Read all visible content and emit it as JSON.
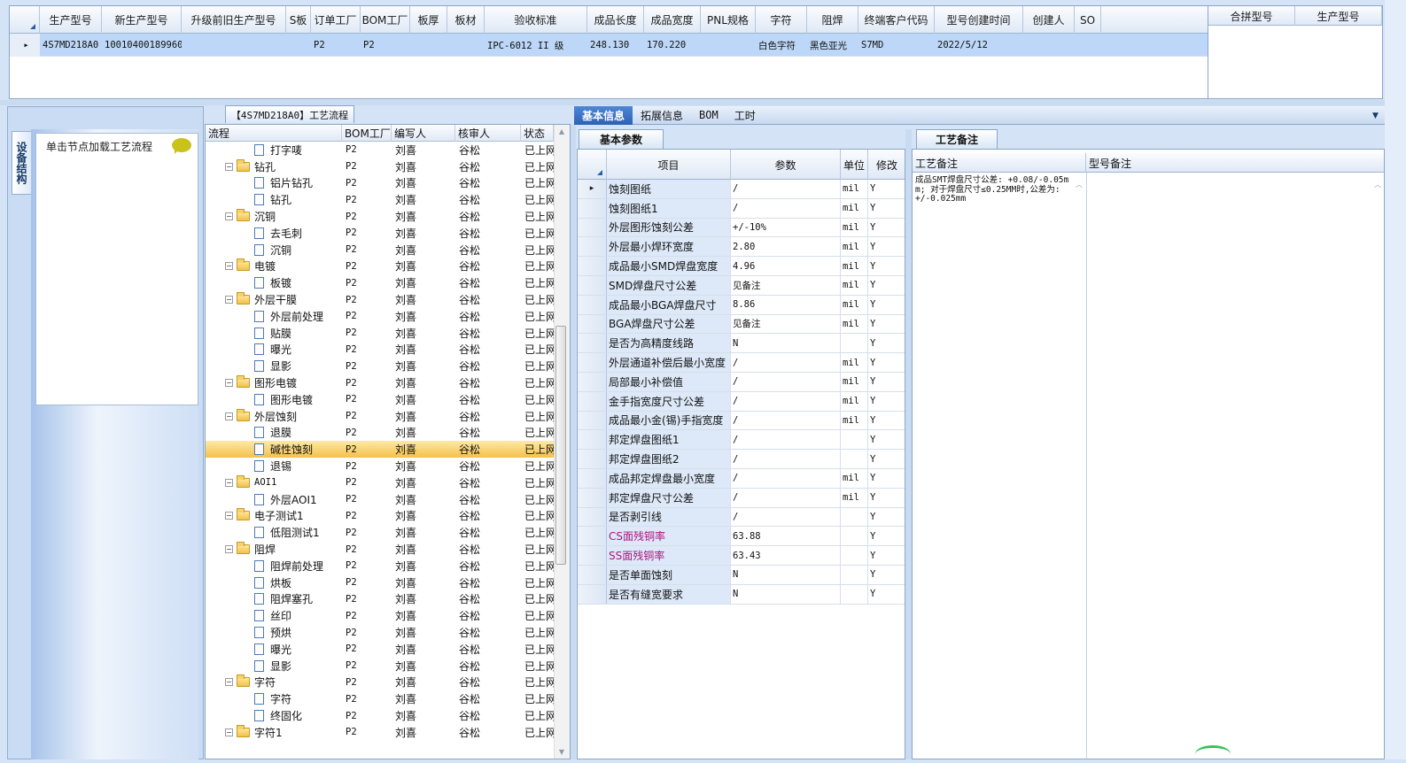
{
  "top_grid": {
    "columns": [
      "生产型号",
      "新生产型号",
      "升级前旧生产型号",
      "S板",
      "订单工厂",
      "BOM工厂",
      "板厚",
      "板材",
      "验收标准",
      "成品长度",
      "成品宽度",
      "PNL规格",
      "字符",
      "阻焊",
      "终端客户代码",
      "型号创建时间",
      "创建人",
      "SO"
    ],
    "row": [
      "4S7MD218A0",
      "10010400189960",
      "",
      "",
      "P2",
      "P2",
      "",
      "",
      "IPC-6012 II 级",
      "248.130",
      "170.220",
      "",
      "白色字符",
      "黑色亚光",
      "S7MD",
      "2022/5/12",
      "",
      ""
    ]
  },
  "right_grid": {
    "columns": [
      "合拼型号",
      "生产型号"
    ]
  },
  "left_panel": {
    "vertical_tab": "设备结构",
    "load_text": "单击节点加载工艺流程"
  },
  "tree": {
    "title": "【4S7MD218A0】工艺流程",
    "columns": [
      "流程",
      "BOM工厂",
      "编写人",
      "核审人",
      "状态"
    ],
    "rows": [
      {
        "name": "打字唛",
        "level": 2,
        "bom": "P2",
        "writer": "刘喜",
        "reviewer": "谷松",
        "status": "已上网"
      },
      {
        "name": "钻孔",
        "level": 1,
        "bom": "P2",
        "writer": "刘喜",
        "reviewer": "谷松",
        "status": "已上网"
      },
      {
        "name": "铝片钻孔",
        "level": 2,
        "bom": "P2",
        "writer": "刘喜",
        "reviewer": "谷松",
        "status": "已上网"
      },
      {
        "name": "钻孔",
        "level": 2,
        "bom": "P2",
        "writer": "刘喜",
        "reviewer": "谷松",
        "status": "已上网"
      },
      {
        "name": "沉铜",
        "level": 1,
        "bom": "P2",
        "writer": "刘喜",
        "reviewer": "谷松",
        "status": "已上网"
      },
      {
        "name": "去毛刺",
        "level": 2,
        "bom": "P2",
        "writer": "刘喜",
        "reviewer": "谷松",
        "status": "已上网"
      },
      {
        "name": "沉铜",
        "level": 2,
        "bom": "P2",
        "writer": "刘喜",
        "reviewer": "谷松",
        "status": "已上网"
      },
      {
        "name": "电镀",
        "level": 1,
        "bom": "P2",
        "writer": "刘喜",
        "reviewer": "谷松",
        "status": "已上网"
      },
      {
        "name": "板镀",
        "level": 2,
        "bom": "P2",
        "writer": "刘喜",
        "reviewer": "谷松",
        "status": "已上网"
      },
      {
        "name": "外层干膜",
        "level": 1,
        "bom": "P2",
        "writer": "刘喜",
        "reviewer": "谷松",
        "status": "已上网"
      },
      {
        "name": "外层前处理",
        "level": 2,
        "bom": "P2",
        "writer": "刘喜",
        "reviewer": "谷松",
        "status": "已上网"
      },
      {
        "name": "贴膜",
        "level": 2,
        "bom": "P2",
        "writer": "刘喜",
        "reviewer": "谷松",
        "status": "已上网"
      },
      {
        "name": "曝光",
        "level": 2,
        "bom": "P2",
        "writer": "刘喜",
        "reviewer": "谷松",
        "status": "已上网"
      },
      {
        "name": "显影",
        "level": 2,
        "bom": "P2",
        "writer": "刘喜",
        "reviewer": "谷松",
        "status": "已上网"
      },
      {
        "name": "图形电镀",
        "level": 1,
        "bom": "P2",
        "writer": "刘喜",
        "reviewer": "谷松",
        "status": "已上网"
      },
      {
        "name": "图形电镀",
        "level": 2,
        "bom": "P2",
        "writer": "刘喜",
        "reviewer": "谷松",
        "status": "已上网"
      },
      {
        "name": "外层蚀刻",
        "level": 1,
        "bom": "P2",
        "writer": "刘喜",
        "reviewer": "谷松",
        "status": "已上网"
      },
      {
        "name": "退膜",
        "level": 2,
        "bom": "P2",
        "writer": "刘喜",
        "reviewer": "谷松",
        "status": "已上网"
      },
      {
        "name": "碱性蚀刻",
        "level": 2,
        "bom": "P2",
        "writer": "刘喜",
        "reviewer": "谷松",
        "status": "已上网",
        "selected": true
      },
      {
        "name": "退锡",
        "level": 2,
        "bom": "P2",
        "writer": "刘喜",
        "reviewer": "谷松",
        "status": "已上网"
      },
      {
        "name": "AOI1",
        "level": 1,
        "bom": "P2",
        "writer": "刘喜",
        "reviewer": "谷松",
        "status": "已上网"
      },
      {
        "name": "外层AOI1",
        "level": 2,
        "bom": "P2",
        "writer": "刘喜",
        "reviewer": "谷松",
        "status": "已上网"
      },
      {
        "name": "电子测试1",
        "level": 1,
        "bom": "P2",
        "writer": "刘喜",
        "reviewer": "谷松",
        "status": "已上网"
      },
      {
        "name": "低阻测试1",
        "level": 2,
        "bom": "P2",
        "writer": "刘喜",
        "reviewer": "谷松",
        "status": "已上网"
      },
      {
        "name": "阻焊",
        "level": 1,
        "bom": "P2",
        "writer": "刘喜",
        "reviewer": "谷松",
        "status": "已上网"
      },
      {
        "name": "阻焊前处理",
        "level": 2,
        "bom": "P2",
        "writer": "刘喜",
        "reviewer": "谷松",
        "status": "已上网"
      },
      {
        "name": "烘板",
        "level": 2,
        "bom": "P2",
        "writer": "刘喜",
        "reviewer": "谷松",
        "status": "已上网"
      },
      {
        "name": "阻焊塞孔",
        "level": 2,
        "bom": "P2",
        "writer": "刘喜",
        "reviewer": "谷松",
        "status": "已上网"
      },
      {
        "name": "丝印",
        "level": 2,
        "bom": "P2",
        "writer": "刘喜",
        "reviewer": "谷松",
        "status": "已上网"
      },
      {
        "name": "预烘",
        "level": 2,
        "bom": "P2",
        "writer": "刘喜",
        "reviewer": "谷松",
        "status": "已上网"
      },
      {
        "name": "曝光",
        "level": 2,
        "bom": "P2",
        "writer": "刘喜",
        "reviewer": "谷松",
        "status": "已上网"
      },
      {
        "name": "显影",
        "level": 2,
        "bom": "P2",
        "writer": "刘喜",
        "reviewer": "谷松",
        "status": "已上网"
      },
      {
        "name": "字符",
        "level": 1,
        "bom": "P2",
        "writer": "刘喜",
        "reviewer": "谷松",
        "status": "已上网"
      },
      {
        "name": "字符",
        "level": 2,
        "bom": "P2",
        "writer": "刘喜",
        "reviewer": "谷松",
        "status": "已上网"
      },
      {
        "name": "终固化",
        "level": 2,
        "bom": "P2",
        "writer": "刘喜",
        "reviewer": "谷松",
        "status": "已上网"
      },
      {
        "name": "字符1",
        "level": 1,
        "bom": "P2",
        "writer": "刘喜",
        "reviewer": "谷松",
        "status": "已上网"
      }
    ]
  },
  "right_tabs": [
    "基本信息",
    "拓展信息",
    "BOM",
    "工时"
  ],
  "params": {
    "tab_label": "基本参数",
    "columns": [
      "项目",
      "参数",
      "单位",
      "修改"
    ],
    "rows": [
      {
        "name": "蚀刻图纸",
        "value": "/",
        "unit": "mil",
        "mod": "Y",
        "pink": false
      },
      {
        "name": "蚀刻图纸1",
        "value": "/",
        "unit": "mil",
        "mod": "Y",
        "pink": false
      },
      {
        "name": "外层图形蚀刻公差",
        "value": "+/-10%",
        "unit": "mil",
        "mod": "Y",
        "pink": false
      },
      {
        "name": "外层最小焊环宽度",
        "value": "2.80",
        "unit": "mil",
        "mod": "Y",
        "pink": false
      },
      {
        "name": "成品最小SMD焊盘宽度",
        "value": "4.96",
        "unit": "mil",
        "mod": "Y",
        "pink": false
      },
      {
        "name": "SMD焊盘尺寸公差",
        "value": "见备注",
        "unit": "mil",
        "mod": "Y",
        "pink": false
      },
      {
        "name": "成品最小BGA焊盘尺寸",
        "value": "8.86",
        "unit": "mil",
        "mod": "Y",
        "pink": false
      },
      {
        "name": "BGA焊盘尺寸公差",
        "value": "见备注",
        "unit": "mil",
        "mod": "Y",
        "pink": false
      },
      {
        "name": "是否为高精度线路",
        "value": "N",
        "unit": "",
        "mod": "Y",
        "pink": false
      },
      {
        "name": "外层通道补偿后最小宽度",
        "value": "/",
        "unit": "mil",
        "mod": "Y",
        "pink": false
      },
      {
        "name": "局部最小补偿值",
        "value": "/",
        "unit": "mil",
        "mod": "Y",
        "pink": false
      },
      {
        "name": "金手指宽度尺寸公差",
        "value": "/",
        "unit": "mil",
        "mod": "Y",
        "pink": false
      },
      {
        "name": "成品最小金(锡)手指宽度",
        "value": "/",
        "unit": "mil",
        "mod": "Y",
        "pink": false
      },
      {
        "name": "邦定焊盘图纸1",
        "value": "/",
        "unit": "",
        "mod": "Y",
        "pink": false
      },
      {
        "name": "邦定焊盘图纸2",
        "value": "/",
        "unit": "",
        "mod": "Y",
        "pink": false
      },
      {
        "name": "成品邦定焊盘最小宽度",
        "value": "/",
        "unit": "mil",
        "mod": "Y",
        "pink": false
      },
      {
        "name": "邦定焊盘尺寸公差",
        "value": "/",
        "unit": "mil",
        "mod": "Y",
        "pink": false
      },
      {
        "name": "是否剥引线",
        "value": "/",
        "unit": "",
        "mod": "Y",
        "pink": false
      },
      {
        "name": "CS面残铜率",
        "value": "63.88",
        "unit": "",
        "mod": "Y",
        "pink": true
      },
      {
        "name": "SS面残铜率",
        "value": "63.43",
        "unit": "",
        "mod": "Y",
        "pink": true
      },
      {
        "name": "是否单面蚀刻",
        "value": "N",
        "unit": "",
        "mod": "Y",
        "pink": false
      },
      {
        "name": "是否有缝宽要求",
        "value": "N",
        "unit": "",
        "mod": "Y",
        "pink": false
      }
    ]
  },
  "remarks": {
    "tab_label": "工艺备注",
    "columns": [
      "工艺备注",
      "型号备注"
    ],
    "process_remark": "成品SMT焊盘尺寸公差: +0.08/-0.05mm; 对于焊盘尺寸≤0.25MM时,公差为: +/-0.025mm"
  }
}
